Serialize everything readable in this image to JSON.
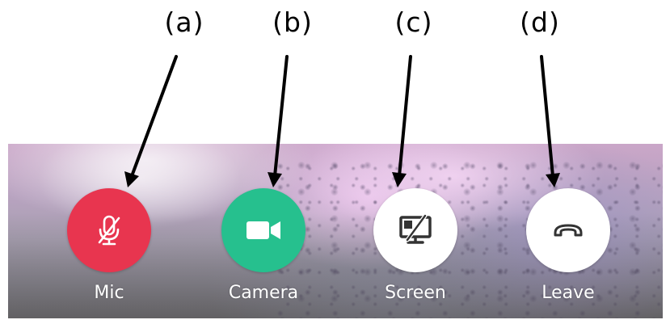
{
  "annotations": {
    "a": "(a)",
    "b": "(b)",
    "c": "(c)",
    "d": "(d)"
  },
  "controls": {
    "mic": {
      "label": "Mic",
      "icon": "mic-off-icon",
      "color": "#e8354f",
      "state": "muted"
    },
    "camera": {
      "label": "Camera",
      "icon": "video-camera-icon",
      "color": "#26c08e",
      "state": "on"
    },
    "screen": {
      "label": "Screen",
      "icon": "screen-share-off-icon",
      "color": "#ffffff"
    },
    "leave": {
      "label": "Leave",
      "icon": "phone-hangup-icon",
      "color": "#ffffff"
    }
  },
  "colors": {
    "icon_on_light": "#333333",
    "icon_on_dark": "#ffffff",
    "label_text": "#ffffff"
  }
}
